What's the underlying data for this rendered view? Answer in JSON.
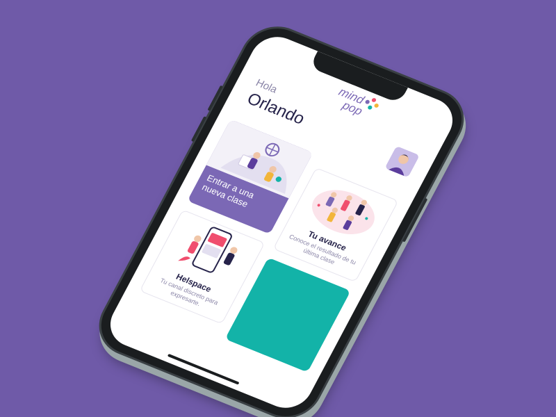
{
  "logo": {
    "line1": "mind",
    "line2": "pop",
    "dot_colors": [
      "#7b68b5",
      "#f04e6e",
      "#13b3a8",
      "#f2b53a"
    ]
  },
  "greeting": {
    "hello": "Hola",
    "user_name": "Orlando"
  },
  "cards": [
    {
      "title": "Entrar a una nueva clase",
      "description": ""
    },
    {
      "title": "Tu avance",
      "description": "Conoce el resultado de tu última clase"
    },
    {
      "title": "Helspace",
      "description": "Tu canal discreto para expresarte."
    },
    {
      "title": "",
      "description": ""
    }
  ],
  "colors": {
    "background": "#6f5aa8",
    "primary": "#7b68b5",
    "teal": "#13b3a8",
    "heading": "#26234a",
    "muted": "#8b86a8"
  }
}
